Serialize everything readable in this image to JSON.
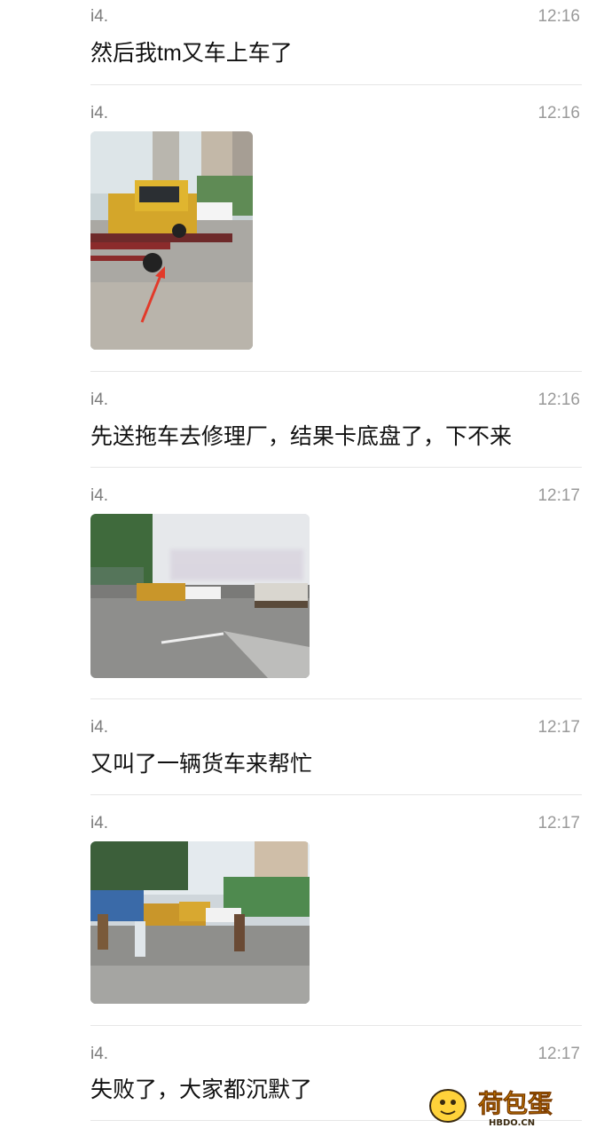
{
  "messages": [
    {
      "type": "text",
      "sender": "i4.",
      "time": "12:16",
      "text": "然后我tm又车上车了"
    },
    {
      "type": "image",
      "sender": "i4.",
      "time": "12:16",
      "image": "photo-tow-truck-stuck-arrow"
    },
    {
      "type": "text",
      "sender": "i4.",
      "time": "12:16",
      "text": "先送拖车去修理厂，结果卡底盘了，下不来"
    },
    {
      "type": "image",
      "sender": "i4.",
      "time": "12:17",
      "image": "photo-street-tow-trucks"
    },
    {
      "type": "text",
      "sender": "i4.",
      "time": "12:17",
      "text": "又叫了一辆货车来帮忙"
    },
    {
      "type": "image",
      "sender": "i4.",
      "time": "12:17",
      "image": "photo-workers-tow-truck"
    },
    {
      "type": "text",
      "sender": "i4.",
      "time": "12:17",
      "text": "失败了，大家都沉默了"
    }
  ],
  "watermark": {
    "logo_text": "荷包蛋",
    "domain": "HBDO.CN"
  },
  "colors": {
    "sender": "#7c7c7c",
    "time": "#9a9a9a",
    "divider": "#e6e6e6",
    "watermark": "#f2a400"
  }
}
